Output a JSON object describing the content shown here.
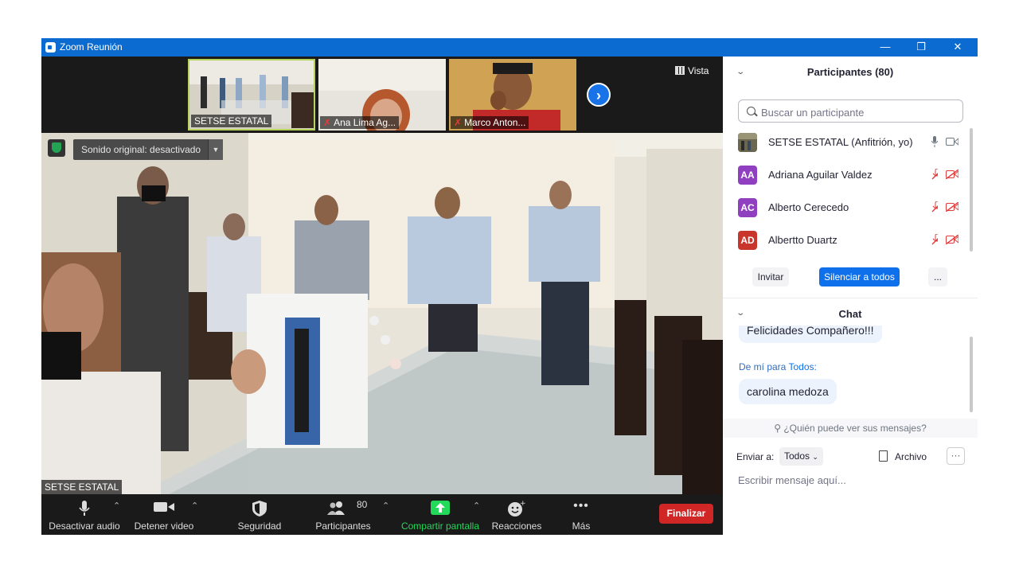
{
  "window": {
    "title": "Zoom Reunión",
    "minimize": "—",
    "restore": "❐",
    "close": "✕"
  },
  "thumbnails": [
    {
      "name": "SETSE ESTATAL",
      "muted": false
    },
    {
      "name": "Ana Lima Ag...",
      "muted": true
    },
    {
      "name": "Marco Anton...",
      "muted": true
    }
  ],
  "view": {
    "label": "Vista"
  },
  "main_video": {
    "name": "SETSE ESTATAL",
    "original_sound": "Sonido original: desactivado"
  },
  "toolbar": {
    "mute": "Desactivar audio",
    "video": "Detener video",
    "security": "Seguridad",
    "participants": "Participantes",
    "participants_count": "80",
    "share": "Compartir pantalla",
    "reactions": "Reacciones",
    "more": "Más",
    "end": "Finalizar"
  },
  "participants_panel": {
    "title": "Participantes (80)",
    "search_placeholder": "Buscar un participante",
    "list": [
      {
        "name": "SETSE ESTATAL (Anfitrión, yo)",
        "initials": "",
        "color": "#5a5a4a",
        "muted": false
      },
      {
        "name": "Adriana Aguilar Valdez",
        "initials": "AA",
        "color": "#8f3fbf",
        "muted": true
      },
      {
        "name": "Alberto Cerecedo",
        "initials": "AC",
        "color": "#8f3fbf",
        "muted": true
      },
      {
        "name": "Albertto Duartz",
        "initials": "AD",
        "color": "#c8352b",
        "muted": true
      }
    ],
    "invite": "Invitar",
    "mute_all": "Silenciar a todos",
    "more": "..."
  },
  "chat": {
    "title": "Chat",
    "prev_message": "Felicidades Compañero!!!",
    "from_prefix": "De mí para",
    "from_target": "Todos:",
    "message": "carolina medoza",
    "who_sees": "¿Quién puede ver sus mensajes?",
    "send_to_label": "Enviar a:",
    "send_to_value": "Todos",
    "file_label": "Archivo",
    "more": "···",
    "input_placeholder": "Escribir mensaje aquí..."
  },
  "colors": {
    "titlebar": "#0b6bd0",
    "accent": "#0e71eb",
    "end": "#d02626",
    "share": "#23d959",
    "muted": "#e23b3b"
  }
}
